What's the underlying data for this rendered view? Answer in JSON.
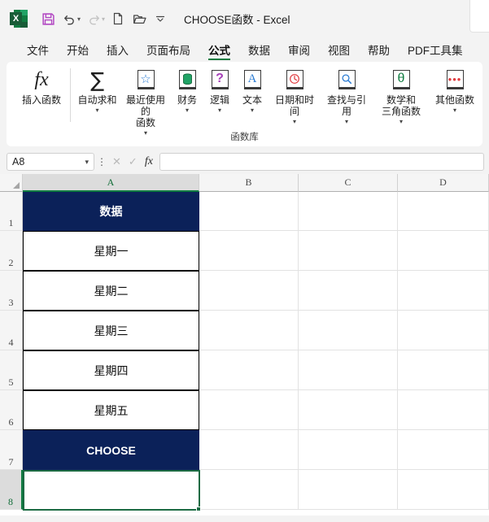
{
  "titlebar": {
    "app_icon": "excel-logo",
    "logo_letter": "X",
    "doc_title": "CHOOSE函数  -  Excel",
    "quick_access": [
      {
        "name": "save-icon",
        "glyph": "ὋE"
      },
      {
        "name": "undo-icon",
        "glyph": "↶"
      },
      {
        "name": "redo-icon",
        "glyph": "↷"
      },
      {
        "name": "new-file-icon",
        "glyph": "὜B"
      },
      {
        "name": "open-folder-icon",
        "glyph": "὜1"
      },
      {
        "name": "customize-qat-icon",
        "glyph": "⌄"
      }
    ]
  },
  "menubar": {
    "items": [
      {
        "label": "文件",
        "active": false
      },
      {
        "label": "开始",
        "active": false
      },
      {
        "label": "插入",
        "active": false
      },
      {
        "label": "页面布局",
        "active": false
      },
      {
        "label": "公式",
        "active": true
      },
      {
        "label": "数据",
        "active": false
      },
      {
        "label": "审阅",
        "active": false
      },
      {
        "label": "视图",
        "active": false
      },
      {
        "label": "帮助",
        "active": false
      },
      {
        "label": "PDF工具集",
        "active": false
      }
    ]
  },
  "ribbon": {
    "group_label": "函数库",
    "buttons": [
      {
        "label": "插入函数",
        "icon": "fx-icon",
        "glyph": "fx",
        "has_caret": false,
        "kind": "fx"
      },
      {
        "label": "自动求和",
        "icon": "autosum-sigma-icon",
        "glyph": "∑",
        "has_caret": true,
        "kind": "sigma"
      },
      {
        "label": "最近使用的\n函数",
        "icon": "recent-functions-star-icon",
        "glyph": "☆",
        "has_caret": true,
        "kind": "book",
        "color": "#2B7CD3"
      },
      {
        "label": "财务",
        "icon": "financial-database-icon",
        "glyph": "⌸",
        "has_caret": true,
        "kind": "book",
        "color": "#107C41"
      },
      {
        "label": "逻辑",
        "icon": "logical-question-icon",
        "glyph": "?",
        "has_caret": true,
        "kind": "book",
        "color": "#A640B8"
      },
      {
        "label": "文本",
        "icon": "text-letter-a-icon",
        "glyph": "A",
        "has_caret": true,
        "kind": "book",
        "color": "#2B7CD3"
      },
      {
        "label": "日期和时间",
        "icon": "date-time-clock-icon",
        "glyph": "◷",
        "has_caret": true,
        "kind": "book",
        "color": "#E03A3E"
      },
      {
        "label": "查找与引用",
        "icon": "lookup-search-icon",
        "glyph": "⚲",
        "has_caret": true,
        "kind": "book",
        "color": "#2B7CD3"
      },
      {
        "label": "数学和\n三角函数",
        "icon": "math-trig-theta-icon",
        "glyph": "θ",
        "has_caret": true,
        "kind": "book",
        "color": "#107C41"
      },
      {
        "label": "其他函数",
        "icon": "more-functions-dots-icon",
        "glyph": "•••",
        "has_caret": true,
        "kind": "book",
        "color": "#E03A3E"
      }
    ]
  },
  "formulabar": {
    "name_box_value": "A8",
    "cancel_icon": "✕",
    "confirm_icon": "✓",
    "fx_icon": "fx",
    "formula_value": "",
    "formula_placeholder": ""
  },
  "grid": {
    "columns": [
      {
        "label": "A",
        "selected": true
      },
      {
        "label": "B",
        "selected": false
      },
      {
        "label": "C",
        "selected": false
      },
      {
        "label": "D",
        "selected": false
      }
    ],
    "rows": [
      {
        "label": "1",
        "selected": false
      },
      {
        "label": "2",
        "selected": false
      },
      {
        "label": "3",
        "selected": false
      },
      {
        "label": "4",
        "selected": false
      },
      {
        "label": "5",
        "selected": false
      },
      {
        "label": "6",
        "selected": false
      },
      {
        "label": "7",
        "selected": false
      },
      {
        "label": "8",
        "selected": true
      }
    ],
    "cells": [
      {
        "ref": "A1",
        "value": "数据",
        "style": "header"
      },
      {
        "ref": "A2",
        "value": "星期一",
        "style": "body"
      },
      {
        "ref": "A3",
        "value": "星期二",
        "style": "body"
      },
      {
        "ref": "A4",
        "value": "星期三",
        "style": "body"
      },
      {
        "ref": "A5",
        "value": "星期四",
        "style": "body"
      },
      {
        "ref": "A6",
        "value": "星期五",
        "style": "body"
      },
      {
        "ref": "A7",
        "value": "CHOOSE",
        "style": "header"
      },
      {
        "ref": "A8",
        "value": "",
        "style": "empty"
      }
    ],
    "selected_cell": "A8"
  },
  "colors": {
    "accent_green": "#107C41",
    "header_navy": "#0B2159",
    "selection_green": "#1C6B43",
    "ribbon_bg": "#FFFFFF",
    "app_bg": "#F3F3F3"
  }
}
